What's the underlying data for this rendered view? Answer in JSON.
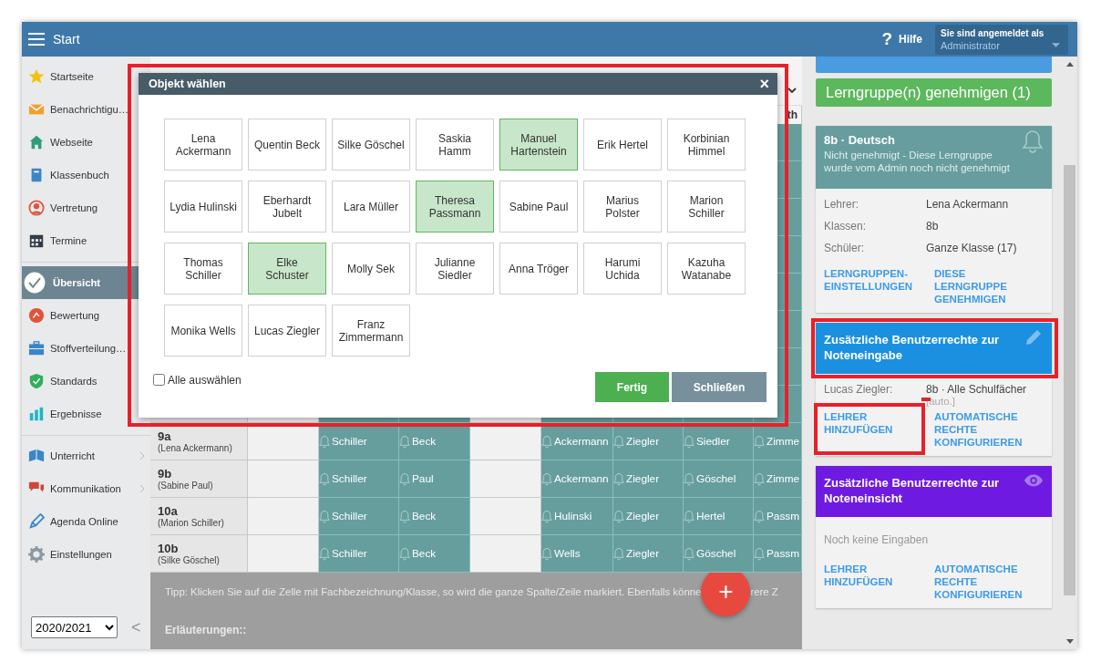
{
  "topbar": {
    "title": "Start",
    "help_icon": "?",
    "help": "Hilfe",
    "login_label": "Sie sind angemeldet als",
    "login_user": "Administrator"
  },
  "sidebar": {
    "groups": [
      [
        {
          "label": "Startseite",
          "kind": "star",
          "active": false
        },
        {
          "label": "Benachrichtigu…",
          "kind": "mail",
          "active": false
        },
        {
          "label": "Webseite",
          "kind": "home",
          "active": false
        },
        {
          "label": "Klassenbuch",
          "kind": "book",
          "active": false
        },
        {
          "label": "Vertretung",
          "kind": "person",
          "active": false
        },
        {
          "label": "Termine",
          "kind": "calendar",
          "active": false
        }
      ],
      [
        {
          "label": "Übersicht",
          "kind": "check",
          "active": true
        },
        {
          "label": "Bewertung",
          "kind": "grade",
          "active": false
        },
        {
          "label": "Stoffverteilung…",
          "kind": "briefcase",
          "active": false
        },
        {
          "label": "Standards",
          "kind": "shield",
          "active": false
        },
        {
          "label": "Ergebnisse",
          "kind": "bars",
          "active": false
        }
      ],
      [
        {
          "label": "Unterricht",
          "kind": "openbook",
          "active": false,
          "submenu": true
        },
        {
          "label": "Kommunikation",
          "kind": "chat",
          "active": false,
          "submenu": true
        },
        {
          "label": "Agenda Online",
          "kind": "pen",
          "active": false,
          "submenu": false
        },
        {
          "label": "Einstellungen",
          "kind": "gear",
          "active": false,
          "submenu": false
        }
      ]
    ],
    "year": "2020/2021",
    "collapse": "<"
  },
  "table": {
    "last_column_header": "th",
    "rows": [
      {
        "class": "9a",
        "teacher": "(Lena Ackermann)",
        "cells": [
          {
            "kind": "empty"
          },
          {
            "kind": "teacher",
            "name": "Schiller"
          },
          {
            "kind": "teacher",
            "name": "Beck"
          },
          {
            "kind": "empty"
          },
          {
            "kind": "teacher",
            "name": "Ackermann"
          },
          {
            "kind": "teacher",
            "name": "Ziegler"
          },
          {
            "kind": "teacher",
            "name": "Siedler"
          },
          {
            "kind": "teacher",
            "name": "Zimme"
          }
        ]
      },
      {
        "class": "9b",
        "teacher": "(Sabine Paul)",
        "cells": [
          {
            "kind": "empty"
          },
          {
            "kind": "teacher",
            "name": "Schiller"
          },
          {
            "kind": "teacher",
            "name": "Paul"
          },
          {
            "kind": "empty"
          },
          {
            "kind": "teacher",
            "name": "Ackermann"
          },
          {
            "kind": "teacher",
            "name": "Ziegler"
          },
          {
            "kind": "teacher",
            "name": "Göschel"
          },
          {
            "kind": "teacher",
            "name": "Zimme"
          }
        ]
      },
      {
        "class": "10a",
        "teacher": "(Marion Schiller)",
        "cells": [
          {
            "kind": "empty"
          },
          {
            "kind": "teacher",
            "name": "Schiller"
          },
          {
            "kind": "teacher",
            "name": "Beck"
          },
          {
            "kind": "empty"
          },
          {
            "kind": "teacher",
            "name": "Hulinski"
          },
          {
            "kind": "teacher",
            "name": "Ziegler"
          },
          {
            "kind": "teacher",
            "name": "Hertel"
          },
          {
            "kind": "teacher",
            "name": "Passm"
          }
        ]
      },
      {
        "class": "10b",
        "teacher": "(Silke Göschel)",
        "cells": [
          {
            "kind": "empty"
          },
          {
            "kind": "teacher",
            "name": "Schiller"
          },
          {
            "kind": "teacher",
            "name": "Beck"
          },
          {
            "kind": "empty"
          },
          {
            "kind": "teacher",
            "name": "Wells"
          },
          {
            "kind": "teacher",
            "name": "Ziegler"
          },
          {
            "kind": "teacher",
            "name": "Göschel"
          },
          {
            "kind": "teacher",
            "name": "Passm"
          }
        ]
      }
    ]
  },
  "info": {
    "tip_start": "Tipp: Klicken Sie auf die Zelle mit Fachbezeichnung/Klasse, so wird die ganze Spalte/Zeile markiert. Ebenfalls könne",
    "tip_end": "rere Z",
    "heading": "Erläuterungen::"
  },
  "fab": "+",
  "modal": {
    "title": "Objekt wählen",
    "close": "×",
    "highlighted": true,
    "people": [
      {
        "name": "Lena Ackermann",
        "selected": false
      },
      {
        "name": "Quentin Beck",
        "selected": false
      },
      {
        "name": "Silke Göschel",
        "selected": false
      },
      {
        "name": "Saskia Hamm",
        "selected": false
      },
      {
        "name": "Manuel Hartenstein",
        "selected": true
      },
      {
        "name": "Erik Hertel",
        "selected": false
      },
      {
        "name": "Korbinian Himmel",
        "selected": false
      },
      {
        "name": "Lydia Hulinski",
        "selected": false
      },
      {
        "name": "Eberhardt Jubelt",
        "selected": false
      },
      {
        "name": "Lara Müller",
        "selected": false
      },
      {
        "name": "Theresa Passmann",
        "selected": true
      },
      {
        "name": "Sabine Paul",
        "selected": false
      },
      {
        "name": "Marius Polster",
        "selected": false
      },
      {
        "name": "Marion Schiller",
        "selected": false
      },
      {
        "name": "Thomas Schiller",
        "selected": false
      },
      {
        "name": "Elke Schuster",
        "selected": true
      },
      {
        "name": "Molly Sek",
        "selected": false
      },
      {
        "name": "Julianne Siedler",
        "selected": false
      },
      {
        "name": "Anna Tröger",
        "selected": false
      },
      {
        "name": "Harumi Uchida",
        "selected": false
      },
      {
        "name": "Kazuha Watanabe",
        "selected": false
      },
      {
        "name": "Monika Wells",
        "selected": false
      },
      {
        "name": "Lucas Ziegler",
        "selected": false
      },
      {
        "name": "Franz Zimmermann",
        "selected": false
      }
    ],
    "select_all": {
      "label": "Alle auswählen",
      "checked": false
    },
    "buttons": [
      {
        "label": "Fertig",
        "kind": "primary"
      },
      {
        "label": "Schließen",
        "kind": "secondary"
      }
    ]
  },
  "right": {
    "approve_button": "Lerngruppe(n) genehmigen (1)",
    "group_card": {
      "title": "8b · Deutsch",
      "subtitle": "Nicht genehmigt - Diese Lerngruppe wurde vom Admin noch nicht genehmigt",
      "fields": [
        {
          "label": "Lehrer:",
          "value": "Lena Ackermann"
        },
        {
          "label": "Klassen:",
          "value": "8b"
        },
        {
          "label": "Schüler:",
          "value": "Ganze Klasse (17)"
        }
      ],
      "links": [
        {
          "label": "LERNGRUPPEN-EINSTELLUNGEN",
          "highlighted": false
        },
        {
          "label": "DIESE LERNGRUPPE GENEHMIGEN",
          "highlighted": false
        }
      ]
    },
    "rights_cards": [
      {
        "kind": "input",
        "title": "Zusätzliche Benutzerrechte zur Noteneingabe",
        "highlighted": true,
        "entries": [
          {
            "label": "Lucas Ziegler:",
            "value": "8b · Alle Schulfächer",
            "note": "[auto.]",
            "note_marked": true
          }
        ],
        "links": [
          {
            "label": "LEHRER HINZUFÜGEN",
            "highlighted": true
          },
          {
            "label": "AUTOMATISCHE RECHTE KONFIGURIEREN",
            "highlighted": false
          }
        ]
      },
      {
        "kind": "view",
        "title": "Zusätzliche Benutzerrechte zur Noteneinsicht",
        "highlighted": false,
        "empty_text": "Noch keine Eingaben",
        "links": [
          {
            "label": "LEHRER HINZUFÜGEN",
            "highlighted": false
          },
          {
            "label": "AUTOMATISCHE RECHTE KONFIGURIEREN",
            "highlighted": false
          }
        ]
      }
    ]
  }
}
